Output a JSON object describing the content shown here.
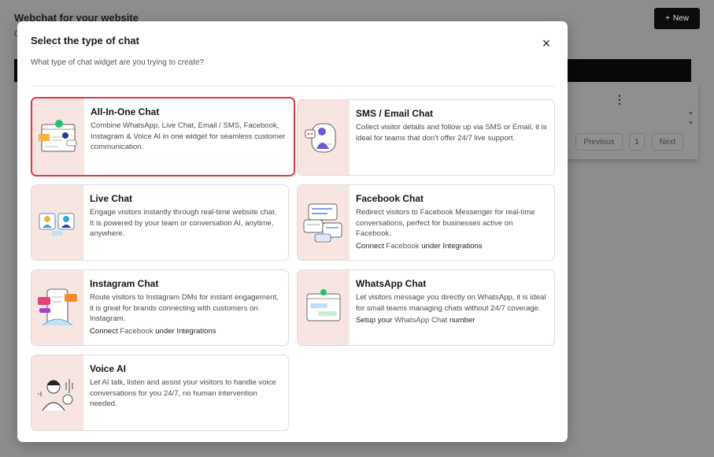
{
  "background": {
    "page_title": "Webchat for your website",
    "page_subtitle": "C",
    "new_button": {
      "icon": "+",
      "label": "New"
    },
    "kebab": "⋮",
    "pagination": {
      "previous": "Previous",
      "page": "1",
      "next": "Next"
    }
  },
  "modal": {
    "title": "Select the type of chat",
    "subtitle": "What type of chat widget are you trying to create?",
    "close_icon": "×",
    "options": [
      {
        "title": "All-In-One Chat",
        "description": "Combine WhatsApp, Live Chat, Email / SMS, Facebook, Instagram & Voice AI in one widget for seamless customer communication.",
        "selected": true,
        "icon": "all-in-one-chat-illustration"
      },
      {
        "title": "SMS / Email Chat",
        "description": "Collect visitor details and follow up via SMS or Email, it is ideal for teams that don't offer 24/7 live support.",
        "icon": "sms-email-illustration"
      },
      {
        "title": "Live Chat",
        "description": "Engage visitors instantly through real-time website chat. It is powered by your team or conversation AI, anytime, anywhere.",
        "icon": "live-chat-illustration"
      },
      {
        "title": "Facebook Chat",
        "description": "Redirect visitors to Facebook Messenger for real-time conversations, perfect for businesses active on Facebook.",
        "note_prefix": "Connect ",
        "note_link": "Facebook",
        "note_suffix": " under Integrations",
        "icon": "facebook-chat-illustration"
      },
      {
        "title": "Instagram Chat",
        "description": "Route visitors to Instagram DMs for instant engagement, it is great for brands connecting with customers on Instagram.",
        "note_prefix": "Connect ",
        "note_link": "Facebook",
        "note_suffix": " under Integrations",
        "icon": "instagram-chat-illustration"
      },
      {
        "title": "WhatsApp Chat",
        "description": "Let visitors message you directly on WhatsApp, it is ideal for small teams managing chats without 24/7 coverage.",
        "note_prefix": "Setup your ",
        "note_link": "WhatsApp Chat",
        "note_suffix": " number",
        "icon": "whatsapp-chat-illustration"
      },
      {
        "title": "Voice AI",
        "description": "Let AI talk, listen and assist your visitors to handle voice conversations for you 24/7, no human intervention needed.",
        "icon": "voice-ai-illustration"
      }
    ]
  },
  "colors": {
    "selected_border": "#e0373c",
    "thumb_bg": "#f7e5e2",
    "overlay": "#8d8d8d"
  }
}
